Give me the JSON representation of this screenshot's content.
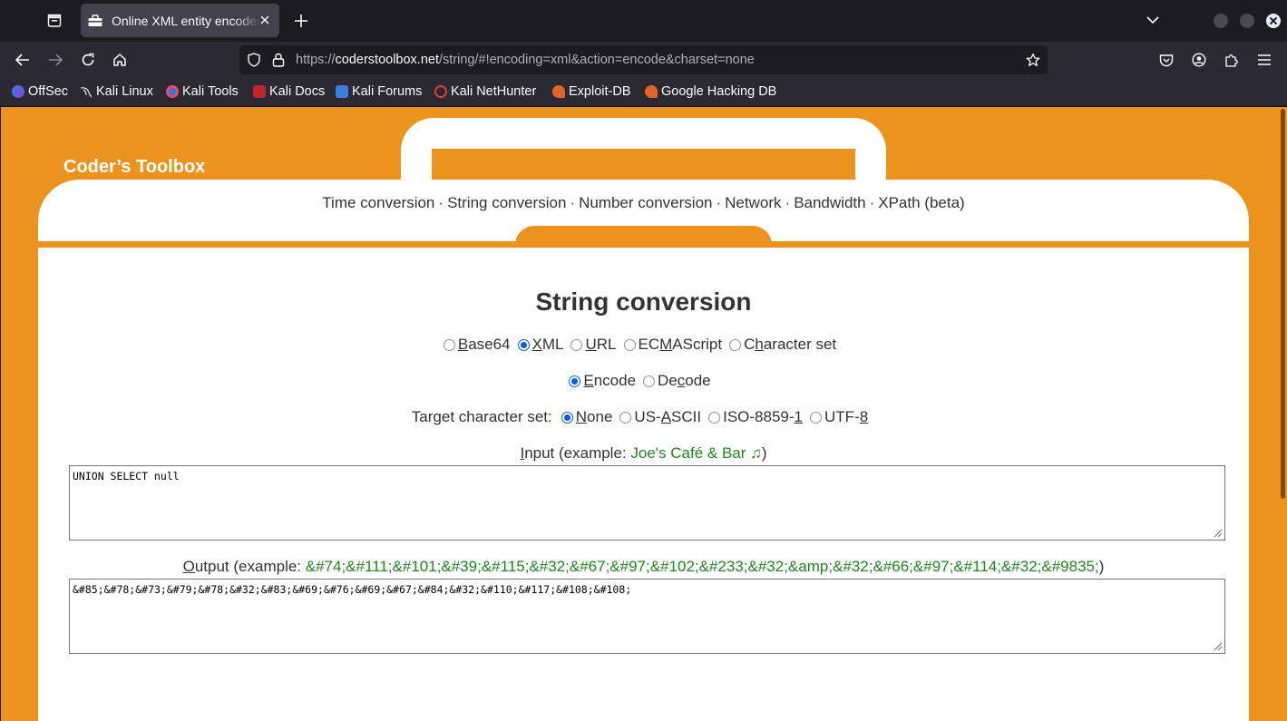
{
  "browser": {
    "tab_title": "Online XML entity encoder/decoder",
    "url_prefix": "https://",
    "url_host": "coderstoolbox.net",
    "url_rest": "/string/#!encoding=xml&action=encode&charset=none",
    "bookmarks": [
      "OffSec",
      "Kali Linux",
      "Kali Tools",
      "Kali Docs",
      "Kali Forums",
      "Kali NetHunter",
      "Exploit-DB",
      "Google Hacking DB"
    ]
  },
  "site": {
    "title": "Coder’s Toolbox",
    "nav": [
      "Time conversion",
      "String conversion",
      "Number conversion",
      "Network",
      "Bandwidth",
      "XPath (beta)"
    ],
    "nav_separator": "·"
  },
  "form": {
    "heading": "String conversion",
    "encodings": [
      {
        "pre": "",
        "key": "B",
        "post": "ase64",
        "selected": false
      },
      {
        "pre": "",
        "key": "X",
        "post": "ML",
        "selected": true
      },
      {
        "pre": "",
        "key": "U",
        "post": "RL",
        "selected": false
      },
      {
        "pre": "EC",
        "key": "M",
        "post": "AScript",
        "selected": false
      },
      {
        "pre": "C",
        "key": "h",
        "post": "aracter set",
        "selected": false
      }
    ],
    "actions": [
      {
        "pre": "",
        "key": "E",
        "post": "ncode",
        "selected": true
      },
      {
        "pre": "De",
        "key": "c",
        "post": "ode",
        "selected": false
      }
    ],
    "charset_label": "Target character set:",
    "charsets": [
      {
        "pre": "",
        "key": "N",
        "post": "one",
        "selected": true
      },
      {
        "pre": "US-",
        "key": "A",
        "post": "SCII",
        "selected": false
      },
      {
        "pre": "ISO-8859-",
        "key": "1",
        "post": "",
        "selected": false
      },
      {
        "pre": "UTF-",
        "key": "8",
        "post": "",
        "selected": false
      }
    ],
    "input_label_key": "I",
    "input_label_rest": "nput (example: ",
    "input_example": "Joe's Café & Bar ♫",
    "input_label_close": ")",
    "input_value": "UNION SELECT null",
    "output_label_key": "O",
    "output_label_rest": "utput (example: ",
    "output_example": "&#74;&#111;&#101;&#39;&#115;&#32;&#67;&#97;&#102;&#233;&#32;&amp;&#32;&#66;&#97;&#114;&#32;&#9835;",
    "output_label_close": ")",
    "output_value": "&#85;&#78;&#73;&#79;&#78;&#32;&#83;&#69;&#76;&#69;&#67;&#84;&#32;&#110;&#117;&#108;&#108;"
  },
  "colors": {
    "page_orange": "#ec931e",
    "example_green": "#1a8a1a",
    "radio_blue": "#0060df"
  }
}
